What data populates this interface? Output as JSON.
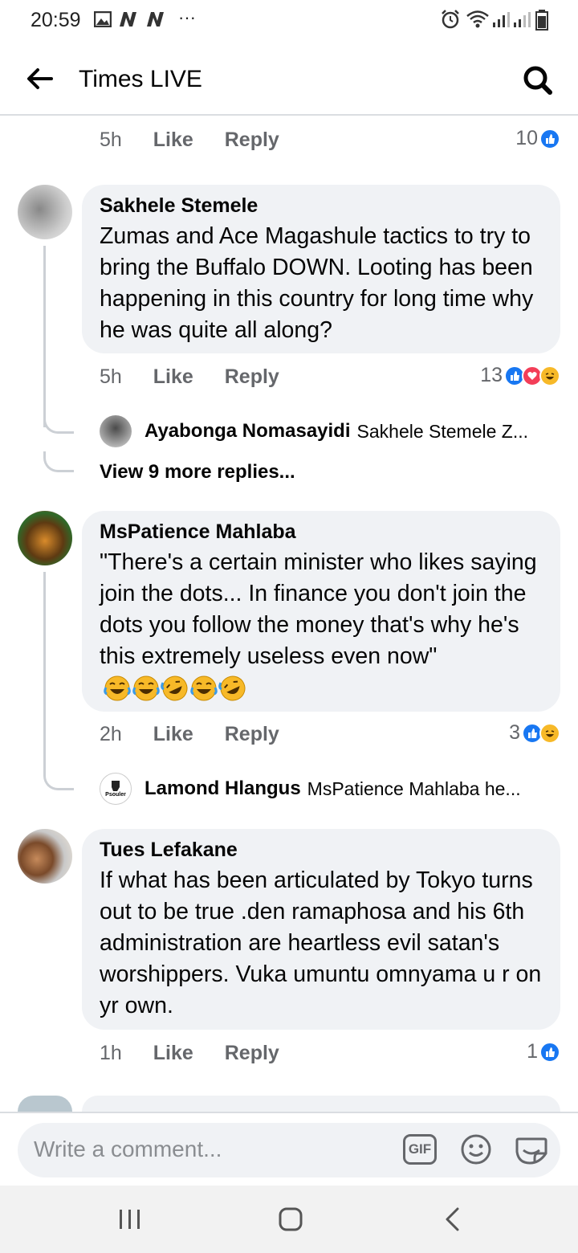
{
  "status_bar": {
    "time": "20:59",
    "more": "···"
  },
  "header": {
    "title": "Times LIVE"
  },
  "top_meta": {
    "time": "5h",
    "like": "Like",
    "reply": "Reply",
    "reaction_count": "10"
  },
  "comments": [
    {
      "author": "Sakhele Stemele",
      "text": "Zumas and Ace Magashule tactics to try to bring the Buffalo DOWN. Looting has been happening in this country for long time why he was quite all along?",
      "time": "5h",
      "like": "Like",
      "reply": "Reply",
      "reaction_count": "13",
      "reply_preview": {
        "author": "Ayabonga Nomasayidi",
        "text": "Sakhele Stemele  Z..."
      },
      "view_more": "View 9 more replies..."
    },
    {
      "author": "MsPatience Mahlaba",
      "text": "\"There's a certain minister who likes saying join the dots... In finance you don't join the dots you follow the money that's why he's this extremely useless even now\"",
      "time": "2h",
      "like": "Like",
      "reply": "Reply",
      "reaction_count": "3",
      "reply_preview": {
        "author": "Lamond Hlangus",
        "text": "MsPatience Mahlaba he...",
        "avatar_text": "Psouler"
      }
    },
    {
      "author": "Tues Lefakane",
      "text": "If what has been articulated by Tokyo turns out to be true .den ramaphosa and his 6th administration are heartless evil satan's worshippers. Vuka umuntu omnyama u r on yr own.",
      "time": "1h",
      "like": "Like",
      "reply": "Reply",
      "reaction_count": "1"
    }
  ],
  "composer": {
    "placeholder": "Write a comment...",
    "gif_label": "GIF"
  },
  "icons": {
    "back": "arrow-left-icon",
    "search": "search-icon",
    "gif": "gif-icon",
    "emoji": "emoji-icon",
    "sticker": "sticker-icon",
    "like_reaction": "like-reaction-icon",
    "love_reaction": "love-reaction-icon",
    "haha_reaction": "haha-reaction-icon"
  },
  "colors": {
    "like_blue": "#1877f2",
    "love_red": "#f33e58",
    "haha_yellow": "#f7b928",
    "bubble_bg": "#f0f2f5",
    "meta_gray": "#65676b"
  }
}
